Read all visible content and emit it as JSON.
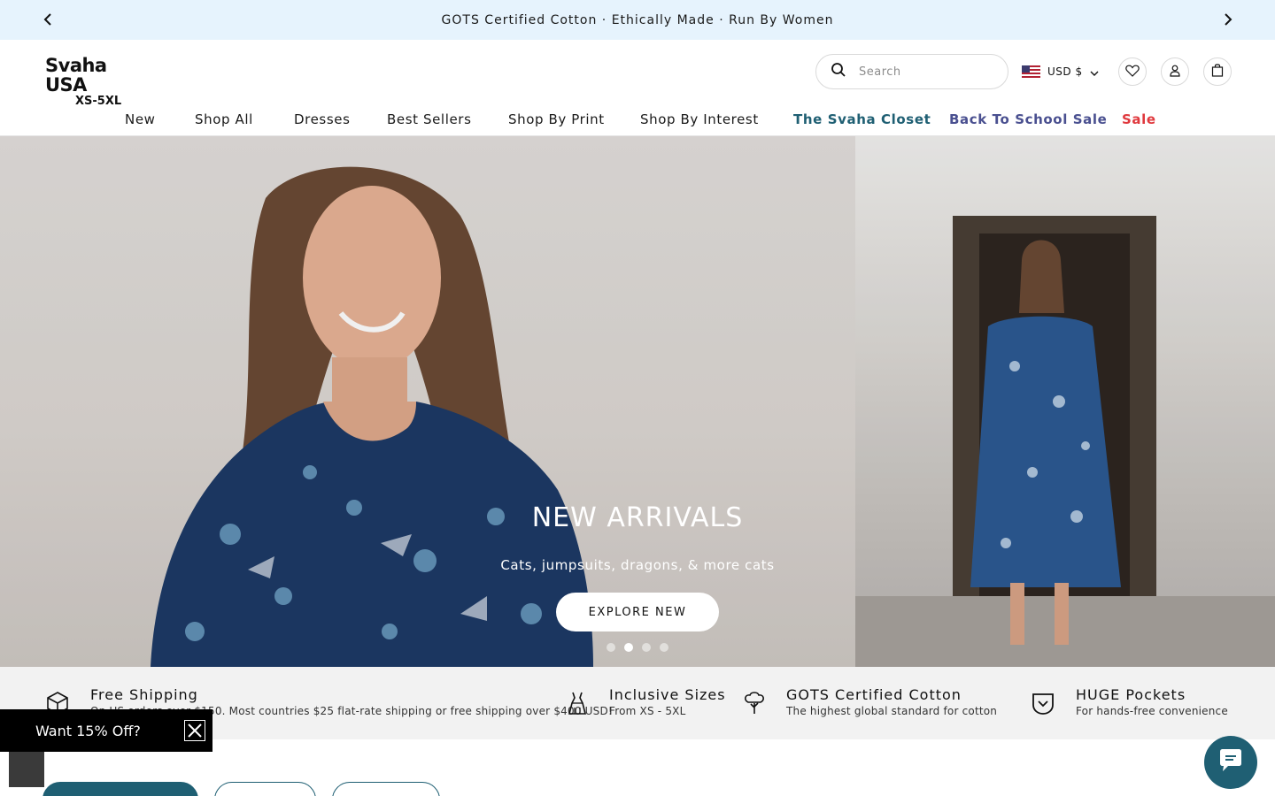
{
  "announcement": {
    "text": "GOTS Certified Cotton · Ethically Made · Run By Women"
  },
  "header": {
    "logo_main": "Svaha USA",
    "logo_sub": "XS-5XL",
    "search_placeholder": "Search",
    "currency": "USD $"
  },
  "nav": {
    "items": [
      {
        "label": "New"
      },
      {
        "label": "Shop All"
      },
      {
        "label": "Dresses"
      },
      {
        "label": "Best Sellers"
      },
      {
        "label": "Shop By Print"
      },
      {
        "label": "Shop By Interest"
      },
      {
        "label": "The Svaha Closet"
      },
      {
        "label": "Back To School Sale"
      },
      {
        "label": "Sale"
      }
    ]
  },
  "hero": {
    "title": "NEW ARRIVALS",
    "subtitle": "Cats, jumpsuits, dragons, & more cats",
    "button": "EXPLORE NEW",
    "slides": 4,
    "active_slide": 2
  },
  "features": [
    {
      "title": "Free Shipping",
      "desc": "On US orders over $150. Most countries $25 flat-rate shipping or free shipping over $400 USD!",
      "icon": "box-icon"
    },
    {
      "title": "Inclusive Sizes",
      "desc": "From XS - 5XL",
      "icon": "dress-icon"
    },
    {
      "title": "GOTS Certified Cotton",
      "desc": "The highest global standard for cotton",
      "icon": "cotton-icon"
    },
    {
      "title": "HUGE Pockets",
      "desc": "For hands-free convenience",
      "icon": "pocket-icon"
    }
  ],
  "promo": {
    "text": "Want 15% Off?"
  },
  "colors": {
    "announcement_bg": "#e6f3fd",
    "accent_teal": "#1f5f73",
    "accent_purple": "#4a5090",
    "sale_red": "#e0393e"
  }
}
